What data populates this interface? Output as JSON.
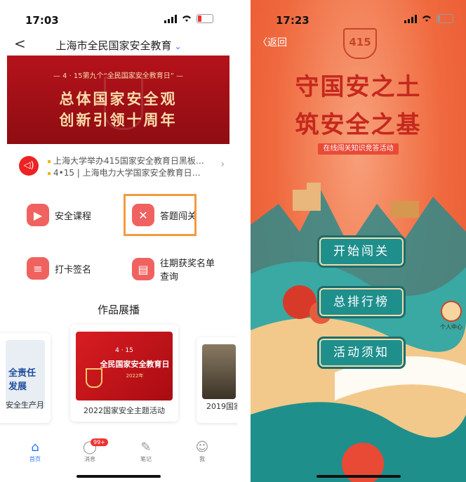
{
  "left": {
    "status": {
      "time": "17:03"
    },
    "nav": {
      "back": "<",
      "title": "上海市全民国家安全教育",
      "dropdown": "⌄"
    },
    "banner": {
      "kicker": "— 4 · 15第九个“全民国家安全教育日” —",
      "line1": "总体国家安全观",
      "line2": "创新引领十周年"
    },
    "news": {
      "items": [
        "上海大学举办415国家安全教育日黑板…",
        "4•15 | 上海电力大学国家安全教育日…"
      ],
      "chevron": "›"
    },
    "features": [
      {
        "label": "安全课程",
        "icon": "▶"
      },
      {
        "label": "答题闯关",
        "icon": "✕"
      },
      {
        "label": "打卡签名",
        "icon": "≡"
      },
      {
        "label": "往期获奖名单查询",
        "label_l1": "往期获奖名单",
        "label_l2": "查询",
        "icon": "▤"
      }
    ],
    "showcase": {
      "title": "作品展播",
      "cards": [
        {
          "label": "安全生产月",
          "image_text": "全责任 发展"
        },
        {
          "label": "2022国家安全主题活动",
          "image_text_1": "4 · 15",
          "image_text_2": "全民国家安全教育日",
          "image_text_3": "2022年"
        },
        {
          "label": "2019国家"
        }
      ]
    },
    "tabbar": {
      "tabs": [
        {
          "label": "首页",
          "icon": "home-icon",
          "active": true
        },
        {
          "label": "消息",
          "icon": "chat-icon",
          "badge": "99+"
        },
        {
          "label": "笔记",
          "icon": "edit-icon"
        },
        {
          "label": "我",
          "icon": "person-icon"
        }
      ]
    },
    "colors": {
      "accent": "#2a79ff",
      "feature": "#f06260",
      "highlight": "#f49a3e",
      "banner": "#b5121b"
    }
  },
  "right": {
    "status": {
      "time": "17:23"
    },
    "back": "返回",
    "emblem": "415",
    "title_line1": "守国安之土",
    "title_line2": "筑安全之基",
    "subtitle": "在线闯关知识竞答活动",
    "buttons": [
      "开始闯关",
      "总排行榜",
      "活动须知"
    ],
    "personal_center": "个人中心",
    "colors": {
      "bg": "#f26a3c",
      "title": "#c5281d",
      "button": "#1f8f8c"
    }
  }
}
